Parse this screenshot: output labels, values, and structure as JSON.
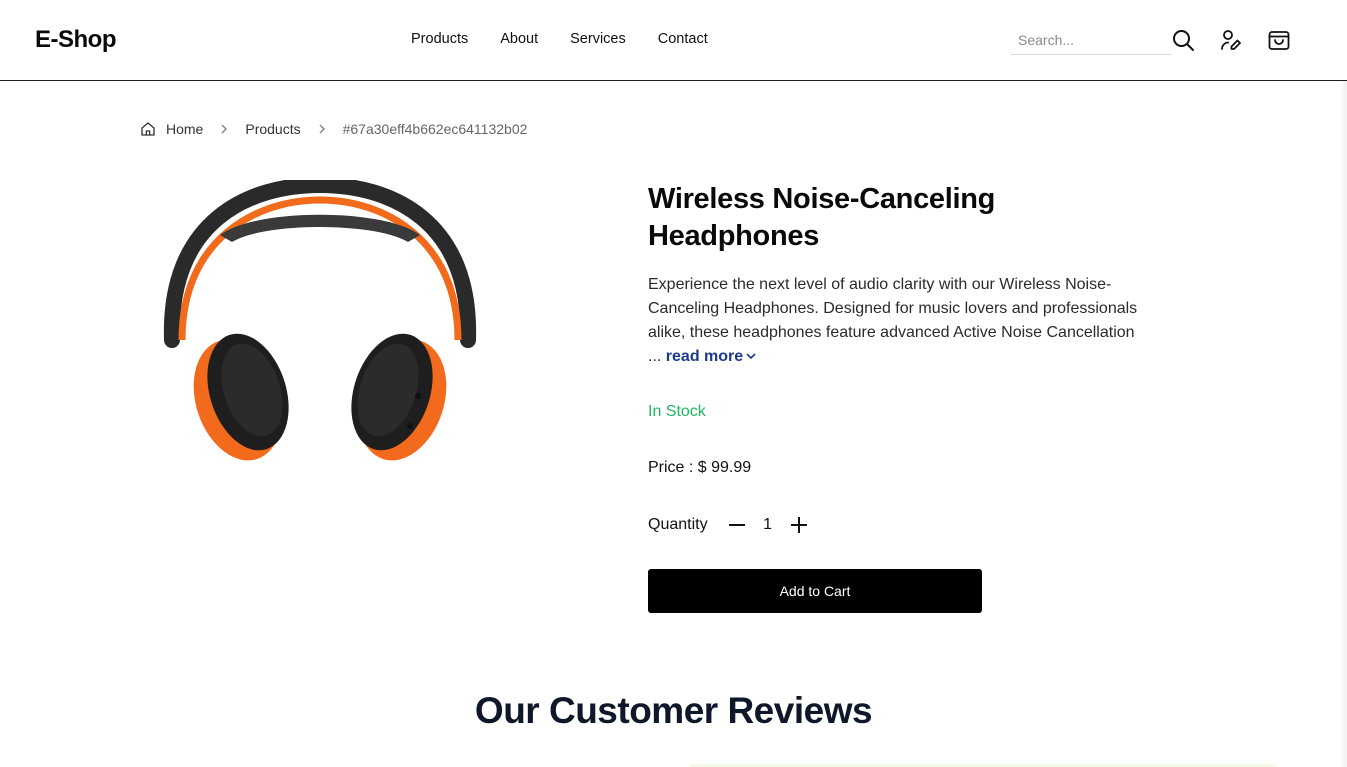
{
  "header": {
    "logo": "E-Shop",
    "nav": [
      "Products",
      "About",
      "Services",
      "Contact"
    ],
    "search_placeholder": "Search...",
    "icons": [
      "search-icon",
      "user-edit-icon",
      "shopping-bag-icon"
    ]
  },
  "breadcrumb": {
    "home": "Home",
    "products": "Products",
    "current": "#67a30eff4b662ec641132b02"
  },
  "product": {
    "title": "Wireless Noise-Canceling Headphones",
    "description": "Experience the next level of audio clarity with our Wireless Noise-Canceling Headphones. Designed for music lovers and professionals alike, these headphones feature advanced Active Noise Cancellation ...",
    "read_more": "read more",
    "stock": "In Stock",
    "price_label": "Price : $ 99.99",
    "quantity_label": "Quantity",
    "quantity": "1",
    "add_to_cart": "Add to Cart"
  },
  "reviews": {
    "title": "Our Customer Reviews"
  },
  "colors": {
    "accent": "#000000",
    "stock_green": "#22b560",
    "link_blue": "#1e3a8a",
    "headphone_orange": "#f26a1b"
  }
}
